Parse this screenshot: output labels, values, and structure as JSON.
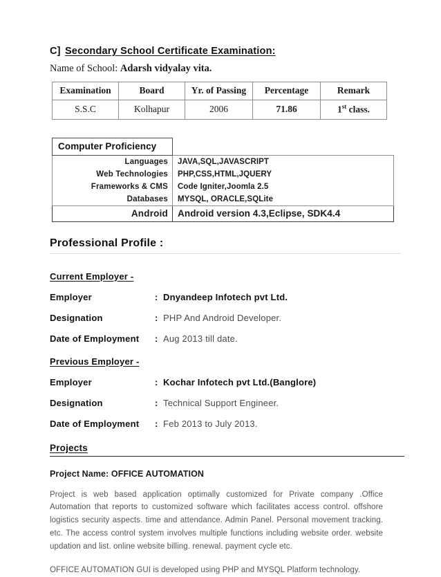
{
  "document": {
    "section_c": {
      "lead": "C]",
      "heading": "Secondary School Certificate Examination:",
      "school_label": "Name of School:",
      "school_name": "Adarsh vidyalay vita."
    },
    "education_table": {
      "headers": [
        "Examination",
        "Board",
        "Yr. of Passing",
        "Percentage",
        "Remark"
      ],
      "rows": [
        {
          "examination": "S.S.C",
          "board": "Kolhapur",
          "year_of_passing": "2006",
          "percentage": "71.86",
          "remark_number": "1",
          "remark_ordinal": "st",
          "remark_rest": " class."
        }
      ]
    },
    "computer_proficiency": {
      "title": "Computer Proficiency",
      "rows": [
        {
          "label": "Languages",
          "value": "JAVA,SQL,JAVASCRIPT"
        },
        {
          "label": "Web Technologies",
          "value": "PHP,CSS,HTML,JQUERY"
        },
        {
          "label": "Frameworks  & CMS",
          "value": "Code Igniter,Joomla  2.5"
        },
        {
          "label": "Databases",
          "value": "MYSQL, ORACLE,SQLite"
        }
      ],
      "android_row": {
        "label": "Android",
        "value": "Android version 4.3,Eclipse, SDK4.4"
      }
    },
    "professional_profile": {
      "title": "Professional Profile :",
      "current_employer": {
        "heading": "Current Employer  -",
        "rows": [
          {
            "label": "Employer",
            "colon": ":",
            "value": "Dnyandeep Infotech pvt Ltd.",
            "emphasis": "strong"
          },
          {
            "label": "Designation",
            "colon": ":",
            "value": "PHP And Android Developer.",
            "emphasis": "normal"
          },
          {
            "label": "Date of Employment",
            "colon": ":",
            "value": "Aug 2013 till date.",
            "emphasis": "normal"
          }
        ]
      },
      "previous_employer": {
        "heading": "Previous Employer -",
        "rows": [
          {
            "label": "Employer",
            "colon": ":",
            "value": "Kochar Infotech pvt Ltd.(Banglore)",
            "emphasis": "strong"
          },
          {
            "label": "Designation",
            "colon": ":",
            "value": "Technical Support Engineer.",
            "emphasis": "normal"
          },
          {
            "label": "Date of Employment",
            "colon": ":",
            "value": "Feb 2013 to July 2013.",
            "emphasis": "normal"
          }
        ]
      }
    },
    "projects": {
      "title": "Projects",
      "project_name": "Project Name: OFFICE AUTOMATION",
      "paragraphs": [
        "Project is web based application  optimally customized for Private company .Office Automation that reports to customized software which facilitates access control. offshore logistics  security aspects. time and attendance. Admin Panel. Personal movement tracking. etc. The access control system involves  multiple functions including website order. website updation and list. online website billing.  renewal. payment cycle  etc.",
        "OFFICE AUTOMATION  GUI is developed using PHP and MYSQL Platform  technology."
      ]
    }
  }
}
